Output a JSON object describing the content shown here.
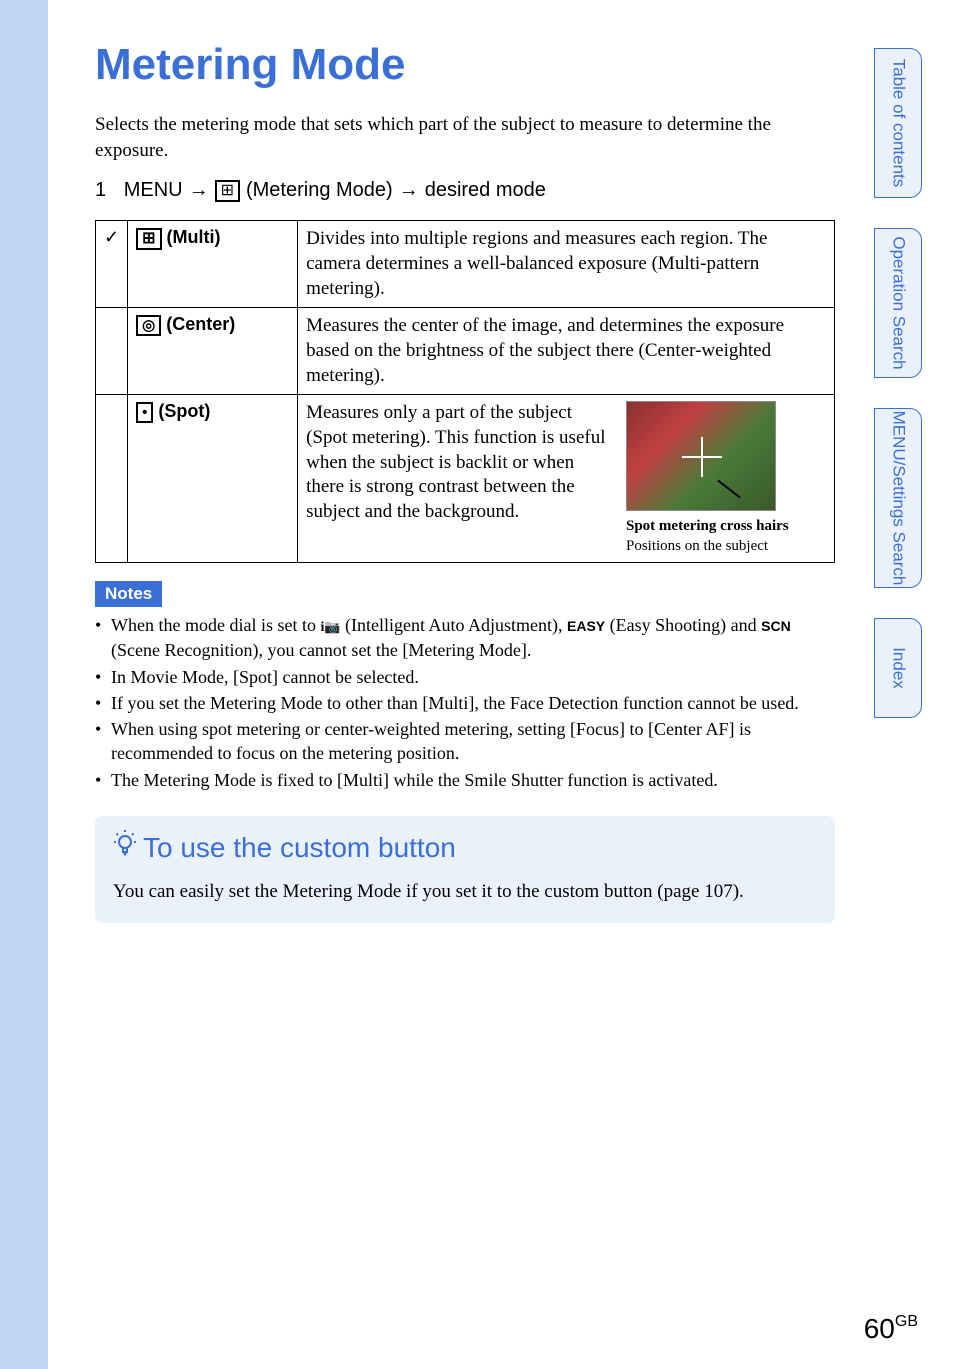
{
  "title": "Metering Mode",
  "intro": "Selects the metering mode that sets which part of the subject to measure to determine the exposure.",
  "step": {
    "num": "1",
    "prefix": "MENU",
    "arrow1": "→",
    "mid": "(Metering Mode)",
    "arrow2": "→",
    "suffix": "desired mode"
  },
  "table": {
    "rows": [
      {
        "check": "✓",
        "name": "(Multi)",
        "desc": "Divides into multiple regions and measures each region. The camera determines a well-balanced exposure (Multi-pattern metering)."
      },
      {
        "check": "",
        "name": "(Center)",
        "desc": "Measures the center of the image, and determines the exposure based on the brightness of the subject there (Center-weighted metering)."
      },
      {
        "check": "",
        "name": "(Spot)",
        "desc": "Measures only a part of the subject (Spot metering). This function is useful when the subject is backlit or when there is strong contrast between the subject and the background.",
        "caption_bold": "Spot metering cross hairs",
        "caption_reg": "Positions on the subject"
      }
    ]
  },
  "notes_label": "Notes",
  "notes": [
    "When the mode dial is set to  (Intelligent Auto Adjustment),  (Easy Shooting) and  (Scene Recognition), you cannot set the [Metering Mode].",
    "In Movie Mode, [Spot] cannot be selected.",
    "If you set the Metering Mode to other than [Multi], the Face Detection function cannot be used.",
    "When using spot metering or center-weighted metering, setting [Focus] to [Center AF] is recommended to focus on the metering position.",
    "The Metering Mode is fixed to [Multi] while the Smile Shutter function is activated."
  ],
  "note1_parts": {
    "p1": "When the mode dial is set to ",
    "p2": " (Intelligent Auto Adjustment), ",
    "p3": " (Easy Shooting) and ",
    "p4": " (Scene Recognition), you cannot set the [Metering Mode].",
    "easy": "EASY",
    "scn": "SCN"
  },
  "tip": {
    "title": "To use the custom button",
    "text": "You can easily set the Metering Mode if you set it to the custom button (page 107)."
  },
  "side": {
    "toc": "Table of\ncontents",
    "op": "Operation\nSearch",
    "menu": "MENU/Settings\nSearch",
    "index": "Index"
  },
  "page": {
    "num": "60",
    "gb": "GB"
  }
}
